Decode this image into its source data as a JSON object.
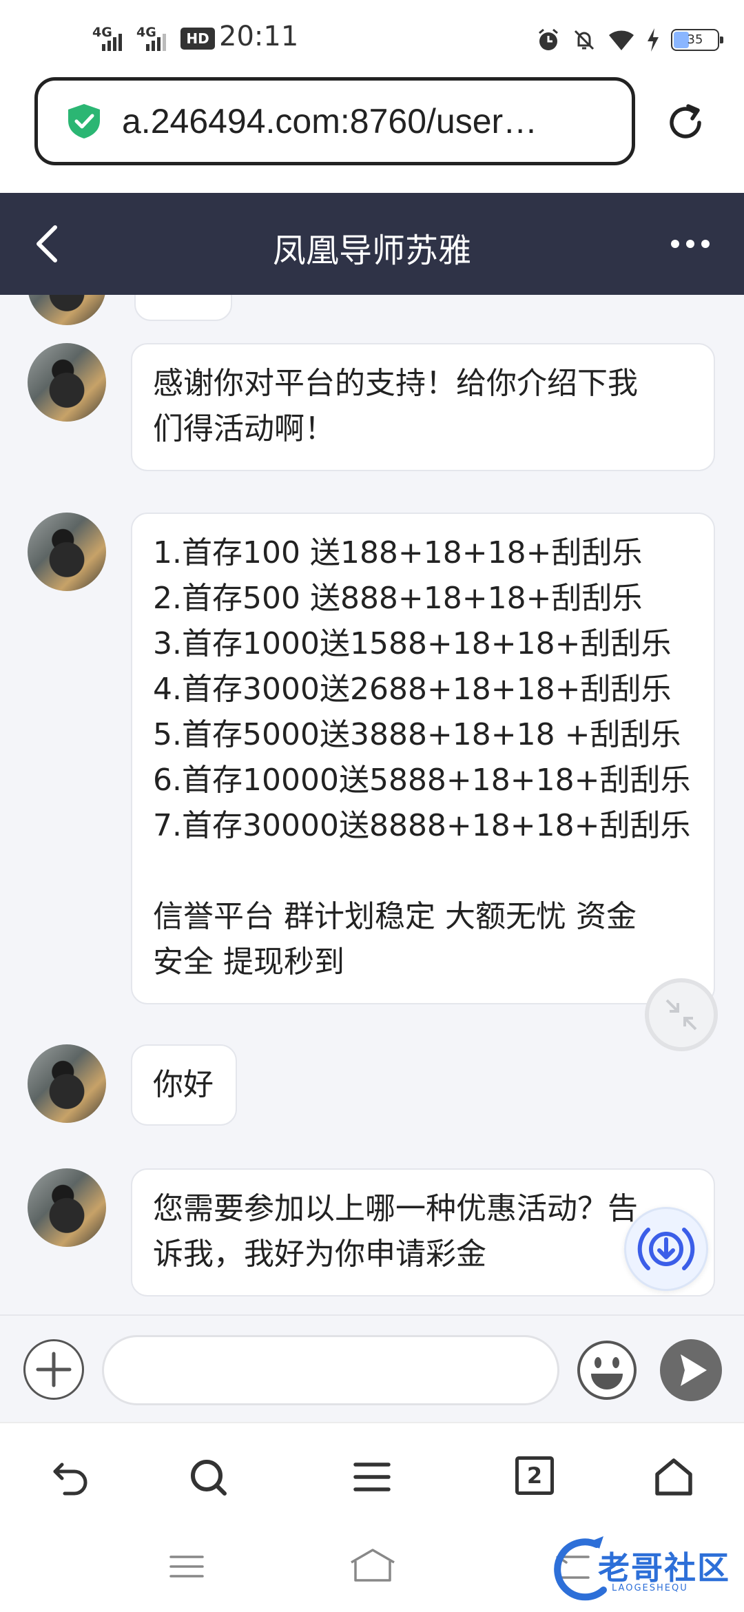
{
  "status_bar": {
    "network_1": "4G",
    "network_2": "4G",
    "hd_badge": "HD",
    "time": "20:11",
    "battery_level": "35",
    "icons": [
      "alarm-icon",
      "mute-icon",
      "wifi-icon",
      "charging-icon",
      "battery-icon"
    ]
  },
  "browser": {
    "url": "a.246494.com:8760/user…",
    "tab_count": "2",
    "security_color": "#2bb673"
  },
  "chat": {
    "title": "凤凰导师苏雅",
    "header_color": "#2f3347",
    "messages": [
      {
        "text": "感谢你对平台的支持！给你介绍下我\n们得活动啊！"
      },
      {
        "text": "1.首存100 送188+18+18+刮刮乐\n2.首存500 送888+18+18+刮刮乐\n3.首存1000送1588+18+18+刮刮乐\n4.首存3000送2688+18+18+刮刮乐\n5.首存5000送3888+18+18 +刮刮乐\n6.首存10000送5888+18+18+刮刮乐\n7.首存30000送8888+18+18+刮刮乐\n\n信誉平台 群计划稳定 大额无忧 资金\n安全 提现秒到"
      },
      {
        "text": "你好"
      },
      {
        "text": "您需要参加以上哪一种优惠活动？告\n诉我，我好为你申请彩金"
      }
    ]
  },
  "input_bar": {
    "placeholder": ""
  },
  "watermark": {
    "text": "老哥社区",
    "sub": "LAOGESHEQU"
  }
}
